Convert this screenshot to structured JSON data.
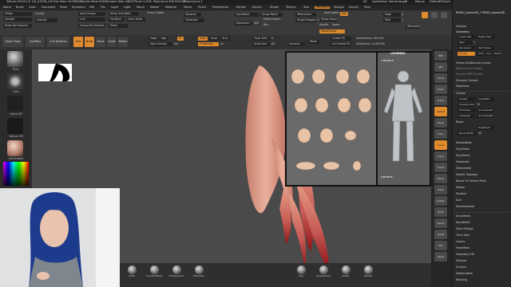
{
  "titlebar": {
    "left": "ZBrush 2024.0.0",
    "mid1": "QS_47076_LM",
    "mid2": "Free Mem 16.630GB",
    "mid3": "Active Mem 6202",
    "mid4": "Scratch Disk 34625",
    "mid5": "Timer 0.018",
    "mid6": "PolyCount 395.904 KP",
    "mid7": "MeshCount 2",
    "ac": "AC",
    "quicksave": "QuickSave",
    "seethrough": "See-through",
    "see_val": "0",
    "menus": "Menus",
    "defaultscript": "DefaultZScript"
  },
  "menus": [
    "Alpha",
    "Brush",
    "Color",
    "Document",
    "Draw",
    "Dynamics",
    "Edit",
    "File",
    "Layer",
    "Light",
    "Macro",
    "Marker",
    "Material",
    "Movie",
    "Picker",
    "Preferences",
    "Render",
    "Stencil",
    "Stroke",
    "Texture",
    "Tool",
    "Transform",
    "Zplugin",
    "Zscript",
    "Help"
  ],
  "topshelf": {
    "inflate": "Inflate",
    "smooth": "Smooth",
    "polish": "Polish By Features",
    "gravity": "Gravity",
    "extrude": "Extrude",
    "auto_groups": "Auto Groups",
    "mirror_weld": "Mirror And Weld",
    "group_visible": "Group Visible",
    "close_holes": "Close Holes",
    "groups_normals": "Groups By Normals",
    "mirror": "Mirror",
    "line": "Line",
    "fix_mesh": "Fix Mesh",
    "dynamic": "Dynamic",
    "thickness": "Thickness",
    "zremesher": "ZRemesher",
    "target": "Target Polygons Count",
    "target_val": "5",
    "dynamesh": "DynaMesh",
    "resolution": "Resolution",
    "resolution_val": "400",
    "group_polish": "Group Polish",
    "polish_label": "Polish",
    "project": "Project",
    "blur": "Blur",
    "split_hidden": "Split Hidden",
    "merge_down": "Merge Down",
    "add": "Add",
    "double": "Double",
    "same": "Same",
    "halfspacing": "KeepGroups",
    "zremesher2": "ZRemesher",
    "edge": "Edge",
    "edge_val": "0",
    "sdiv": "SDiv",
    "sdiv_val": "1",
    "zadd": "Zadd",
    "zsub": "Zsub",
    "zcut": "Zcut"
  },
  "toolrow": {
    "home": "Home Page",
    "lightbox": "LightBox",
    "live": "Live Boolean",
    "edit": "Edit",
    "draw": "Draw",
    "move": "Move",
    "scale": "Scale",
    "rotate": "Rotate",
    "mrgb": "Mrgb",
    "rgb": "Rgb",
    "m": "M",
    "rgb_intensity": "Rgb Intensity",
    "rgb_intensity_val": "100",
    "zadd": "Zadd",
    "zsub": "Zsub",
    "zcut": "Zcut",
    "z_intensity": "Z Intensity",
    "z_intensity_val": "25",
    "focal_shift": "Focal Shift",
    "focal_val": "0",
    "draw_size": "Draw Size",
    "draw_size_val": "64",
    "dynamic": "Dynamic",
    "reset": "Reset",
    "create_pg": "Create PG",
    "unc_pg": "UnCreated PG",
    "active_points": "ActivePoints: 395,904",
    "total_points": "TotalPoints: 31.849 Mil"
  },
  "leftshelf": {
    "brush": "Pinch",
    "stroke": "Dots",
    "alpha": "Alpha Off",
    "texture": "Texture Off",
    "material": "SkinShade4",
    "gradient": "Gradient"
  },
  "righttools": [
    "BPR",
    "SPix",
    "Scroll",
    "Zoom",
    "Actual",
    "AAHalf",
    "Persp",
    "Floor",
    "Local",
    "L.Sym",
    "Frame",
    "Move",
    "Scale",
    "Rotate",
    "PolyF",
    "Transp",
    "Ghost",
    "Solo",
    "Xpose"
  ],
  "rightpanel": {
    "header1": "PM3D_Sphere3D_7",
    "header2": "PM3D_Sphere3D",
    "subtool": "Subtool",
    "geometry": "Geometry",
    "lower_res": "Lower Res",
    "higher_res": "Higher Res",
    "sdiv": "SDiv",
    "sdiv_val": "1",
    "del_lower": "Del Lower",
    "del_higher": "Del Higher",
    "freeze": "Freeze SubDivision Levels",
    "reconstruct": "Reconstruct Subdiv",
    "convert_bpr": "Convert BPR To Geo",
    "divide": "Divide",
    "smt": "Smt",
    "suv": "Suv",
    "reuv": "ReUV",
    "dynamic_subdiv": "Dynamic Subdiv",
    "edge_loop": "EdgeLoop",
    "crease": "Crease",
    "crease_btn": "Crease",
    "crease_pg": "CreasePG",
    "uncrease": "UnCrease",
    "creaseall": "CreaseAll",
    "crease_level": "Crease Level",
    "crease_level_val": "15",
    "uncrease_all": "UnCreaseAll",
    "uncrease_pg": "UnCreasePG",
    "bevel": "Bevel",
    "prop_bevel": "PropBevel",
    "bevel_width": "Bevel Width",
    "bevel_val": "30",
    "shadow_box": "ShadowBox",
    "claypolish": "ClayPolish",
    "dynamesh": "DynaMesh",
    "tessimate": "Tessimate",
    "zremesher": "ZRemesher",
    "modify_topology": "Modify Topology",
    "repair": "Repair To Similar Parts",
    "stager": "Stager",
    "position": "Position",
    "size": "Size",
    "meshintegrity": "MeshIntegrity",
    "arraymesh": "ArrayMesh",
    "nanomesh": "NanoMesh",
    "slime_bridge": "Slime Bridge",
    "thick_skin": "Thick Skin",
    "layers": "Layers",
    "fibermesh": "FiberMesh",
    "geometry_hd": "Geometry HD",
    "preview": "Preview",
    "surface": "Surface",
    "deformation": "Deformation",
    "masking": "Masking"
  },
  "reference": {
    "top_logo": "LEGENDS",
    "fortnite1": "FORTNITE",
    "fortnite2": "FORTNITE"
  },
  "bottomtray": {
    "b1": "Inflat",
    "b2": "CurveFlatDisp",
    "b3": "TrimDynamic",
    "b4": "ZModeler",
    "b5": "Clay",
    "b6": "ClayBuildup",
    "b7": "Polish",
    "b8": "hPolish"
  },
  "colors": {
    "accent": "#e08a2e",
    "panel": "#2a2a2a",
    "canvas": "#4a4a4a",
    "skin": "#e9a68c",
    "blood": "#b31a22"
  }
}
